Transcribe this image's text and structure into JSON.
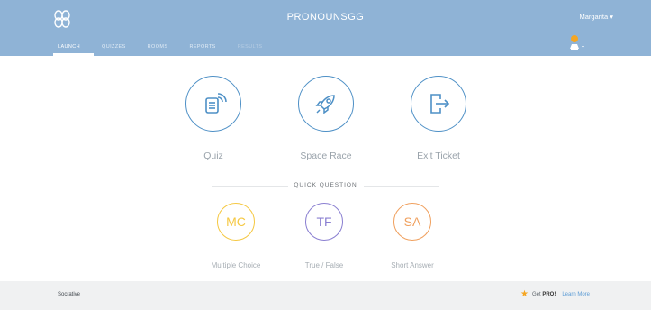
{
  "header": {
    "app_title": "PRONOUNSGG",
    "user_menu": "Margarita ▾",
    "nav": [
      {
        "label": "LAUNCH"
      },
      {
        "label": "QUIZZES"
      },
      {
        "label": "ROOMS"
      },
      {
        "label": "REPORTS"
      },
      {
        "label": "RESULTS"
      }
    ]
  },
  "launch": {
    "quiz": "Quiz",
    "space_race": "Space Race",
    "exit_ticket": "Exit Ticket"
  },
  "quick_question": {
    "title": "QUICK QUESTION",
    "items": [
      {
        "abbr": "MC",
        "label": "Multiple Choice",
        "color": "#f5c842"
      },
      {
        "abbr": "TF",
        "label": "True / False",
        "color": "#8a7fd1"
      },
      {
        "abbr": "SA",
        "label": "Short Answer",
        "color": "#f0a05e"
      }
    ]
  },
  "footer": {
    "left": "Socrative",
    "pro_prefix": "Get",
    "pro": "PRO!",
    "learn_more": "Learn More"
  },
  "colors": {
    "header_bg": "#8fb3d6",
    "launch_ring": "#4e90c6",
    "footer_bg": "#f0f1f2"
  }
}
